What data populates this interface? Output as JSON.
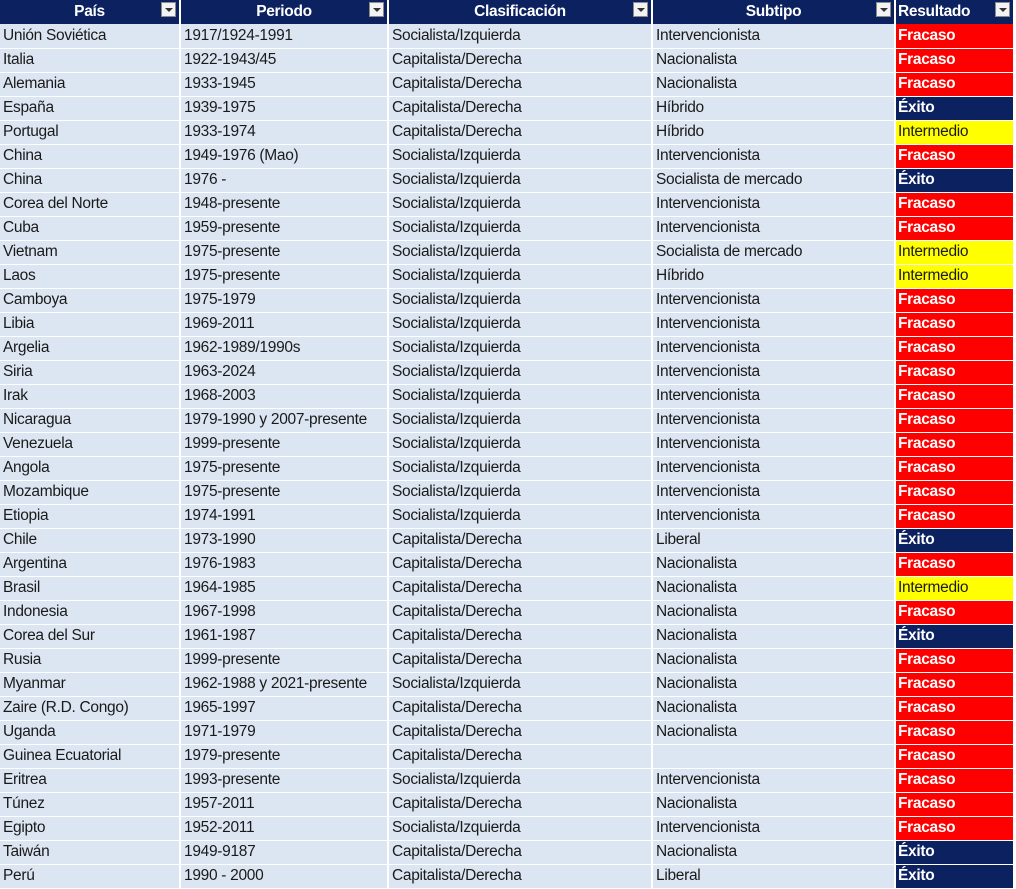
{
  "headers": [
    "País",
    "Periodo",
    "Clasificación",
    "Subtipo",
    "Resultado"
  ],
  "colors": {
    "header_bg": "#0b2160",
    "row_bg": "#dce6f2",
    "fracaso": "#ff0000",
    "intermedio": "#ffff00",
    "exito": "#0b2160"
  },
  "rows": [
    [
      "Unión Soviética",
      "1917/1924-1991",
      "Socialista/Izquierda",
      "Intervencionista",
      "Fracaso"
    ],
    [
      "Italia",
      "1922-1943/45",
      "Capitalista/Derecha",
      "Nacionalista",
      "Fracaso"
    ],
    [
      "Alemania",
      "1933-1945",
      "Capitalista/Derecha",
      "Nacionalista",
      "Fracaso"
    ],
    [
      "España",
      "1939-1975",
      "Capitalista/Derecha",
      "Híbrido",
      "Éxito"
    ],
    [
      "Portugal",
      "1933-1974",
      "Capitalista/Derecha",
      "Híbrido",
      "Intermedio"
    ],
    [
      "China",
      "1949-1976 (Mao)",
      "Socialista/Izquierda",
      "Intervencionista",
      "Fracaso"
    ],
    [
      "China",
      "1976 -",
      "Socialista/Izquierda",
      "Socialista de mercado",
      "Éxito"
    ],
    [
      "Corea del Norte",
      "1948-presente",
      "Socialista/Izquierda",
      "Intervencionista",
      "Fracaso"
    ],
    [
      "Cuba",
      "1959-presente",
      "Socialista/Izquierda",
      "Intervencionista",
      "Fracaso"
    ],
    [
      "Vietnam",
      "1975-presente",
      "Socialista/Izquierda",
      "Socialista de mercado",
      "Intermedio"
    ],
    [
      "Laos",
      "1975-presente",
      "Socialista/Izquierda",
      "Híbrido",
      "Intermedio"
    ],
    [
      "Camboya",
      "1975-1979",
      "Socialista/Izquierda",
      "Intervencionista",
      "Fracaso"
    ],
    [
      "Libia",
      "1969-2011",
      "Socialista/Izquierda",
      "Intervencionista",
      "Fracaso"
    ],
    [
      "Argelia",
      "1962-1989/1990s",
      "Socialista/Izquierda",
      "Intervencionista",
      "Fracaso"
    ],
    [
      "Siria",
      "1963-2024",
      "Socialista/Izquierda",
      "Intervencionista",
      "Fracaso"
    ],
    [
      "Irak",
      "1968-2003",
      "Socialista/Izquierda",
      "Intervencionista",
      "Fracaso"
    ],
    [
      "Nicaragua",
      "1979-1990 y 2007-presente",
      "Socialista/Izquierda",
      "Intervencionista",
      "Fracaso"
    ],
    [
      "Venezuela",
      "1999-presente",
      "Socialista/Izquierda",
      "Intervencionista",
      "Fracaso"
    ],
    [
      "Angola",
      "1975-presente",
      "Socialista/Izquierda",
      "Intervencionista",
      "Fracaso"
    ],
    [
      "Mozambique",
      "1975-presente",
      "Socialista/Izquierda",
      "Intervencionista",
      "Fracaso"
    ],
    [
      "Etiopia",
      "1974-1991",
      "Socialista/Izquierda",
      "Intervencionista",
      "Fracaso"
    ],
    [
      "Chile",
      "1973-1990",
      "Capitalista/Derecha",
      "Liberal",
      "Éxito"
    ],
    [
      "Argentina",
      "1976-1983",
      "Capitalista/Derecha",
      "Nacionalista",
      "Fracaso"
    ],
    [
      "Brasil",
      "1964-1985",
      "Capitalista/Derecha",
      "Nacionalista",
      "Intermedio"
    ],
    [
      "Indonesia",
      "1967-1998",
      "Capitalista/Derecha",
      "Nacionalista",
      "Fracaso"
    ],
    [
      "Corea del Sur",
      "1961-1987",
      "Capitalista/Derecha",
      "Nacionalista",
      "Éxito"
    ],
    [
      "Rusia",
      "1999-presente",
      "Capitalista/Derecha",
      "Nacionalista",
      "Fracaso"
    ],
    [
      "Myanmar",
      "1962-1988 y 2021-presente",
      "Socialista/Izquierda",
      "Nacionalista",
      "Fracaso"
    ],
    [
      "Zaire (R.D. Congo)",
      "1965-1997",
      "Capitalista/Derecha",
      "Nacionalista",
      "Fracaso"
    ],
    [
      "Uganda",
      "1971-1979",
      "Capitalista/Derecha",
      "Nacionalista",
      "Fracaso"
    ],
    [
      "Guinea Ecuatorial",
      "1979-presente",
      "Capitalista/Derecha",
      "",
      "Fracaso"
    ],
    [
      "Eritrea",
      "1993-presente",
      "Socialista/Izquierda",
      "Intervencionista",
      "Fracaso"
    ],
    [
      "Túnez",
      "1957-2011",
      "Capitalista/Derecha",
      "Nacionalista",
      "Fracaso"
    ],
    [
      "Egipto",
      "1952-2011",
      "Socialista/Izquierda",
      "Intervencionista",
      "Fracaso"
    ],
    [
      "Taiwán",
      "1949-9187",
      "Capitalista/Derecha",
      "Nacionalista",
      "Éxito"
    ],
    [
      "Perú",
      "1990 - 2000",
      "Capitalista/Derecha",
      "Liberal",
      "Éxito"
    ]
  ]
}
